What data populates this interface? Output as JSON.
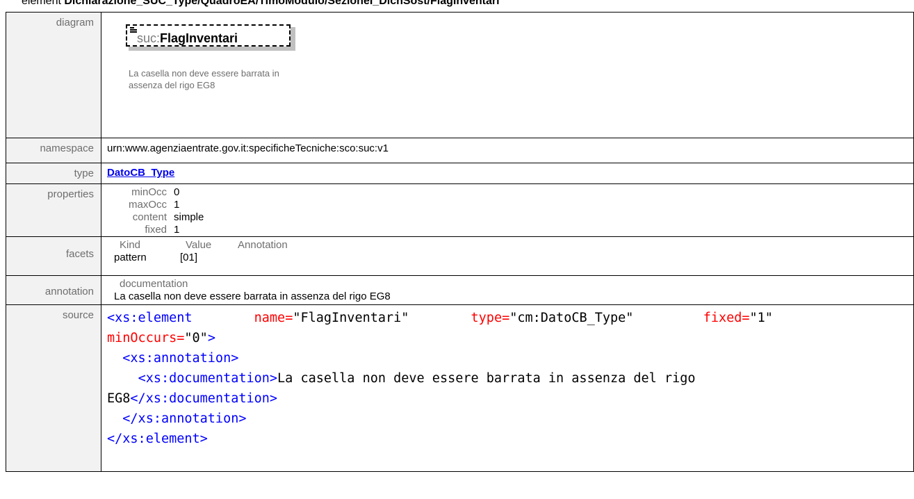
{
  "heading": {
    "prefix": "element ",
    "path": "Dichiarazione_SUC_Type/QuadroEA/TimoModulo/SezioneI_DichSost/FlagInventari"
  },
  "rows": {
    "diagram_label": "diagram",
    "namespace_label": "namespace",
    "type_label": "type",
    "properties_label": "properties",
    "facets_label": "facets",
    "annotation_label": "annotation",
    "source_label": "source"
  },
  "diagram": {
    "prefix": "suc:",
    "name": "FlagInventari",
    "doc": "La casella non deve essere barrata in assenza del rigo EG8",
    "icon": "element-content-icon"
  },
  "namespace": "urn:www.agenziaentrate.gov.it:specificheTecniche:sco:suc:v1",
  "type": "DatoCB_Type",
  "properties": [
    {
      "key": "minOcc",
      "value": "0"
    },
    {
      "key": "maxOcc",
      "value": "1"
    },
    {
      "key": "content",
      "value": "simple"
    },
    {
      "key": "fixed",
      "value": "1"
    }
  ],
  "facets": {
    "headers": [
      "Kind",
      "Value",
      "Annotation"
    ],
    "rows": [
      {
        "kind": "pattern",
        "value": "[01]",
        "annotation": ""
      }
    ]
  },
  "annotation": {
    "head": "documentation",
    "text": "La casella non deve essere barrata in assenza del rigo EG8"
  },
  "source": {
    "line1_tag_open": "<xs:element",
    "attr_name": "name=",
    "attr_name_val": "\"FlagInventari\"",
    "attr_type": "type=",
    "attr_type_val": "\"cm:DatoCB_Type\"",
    "attr_fixed": "fixed=",
    "attr_fixed_val": "\"1\"",
    "attr_minoccurs": "minOccurs=",
    "attr_minoccurs_val": "\"0\"",
    "tag_close_gt": ">",
    "ann_open": "<xs:annotation>",
    "doc_open": "<xs:documentation>",
    "doc_text_a": "La casella non deve essere barrata in assenza del rigo",
    "doc_text_b": "EG8",
    "doc_close": "</xs:documentation>",
    "ann_close": "</xs:annotation>",
    "el_close": "</xs:element>"
  },
  "colors": {
    "tag": "#0000ff",
    "attribute_name": "#ff0000",
    "link": "#0000ee",
    "label_bg": "#f2f2f2"
  }
}
